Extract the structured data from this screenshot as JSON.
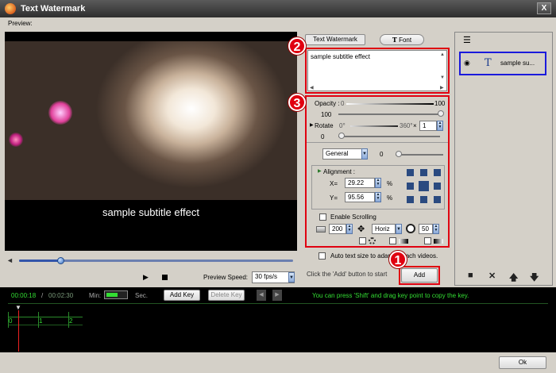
{
  "window": {
    "title": "Text Watermark",
    "close_label": "X"
  },
  "preview": {
    "label": "Preview:",
    "subtitle_text": "sample subtitle effect",
    "speed_label": "Preview Speed:",
    "speed_value": "30 fps/s",
    "volume_level": 0.15
  },
  "tabs": {
    "text_watermark": "Text Watermark",
    "font": "Font",
    "font_icon": "T"
  },
  "editor": {
    "text": "sample subtitle effect"
  },
  "opacity": {
    "label": "Opacity :",
    "min": "0",
    "max": "100",
    "value": "100"
  },
  "rotate": {
    "label": "Rotate",
    "min": "0°",
    "max": "360°",
    "multiply": "×",
    "times": "1",
    "value": "0"
  },
  "motion": {
    "preset": "General",
    "value": "0"
  },
  "alignment": {
    "label": "Alignment :",
    "x_label": "X=",
    "x_value": "29.22",
    "y_label": "Y=",
    "y_value": "95.56",
    "unit": "%"
  },
  "scrolling": {
    "label": "Enable Scrolling",
    "width": "200",
    "direction": "Horiz",
    "speed": "50"
  },
  "auto_text": {
    "label": "Auto text size to adapt to each videos."
  },
  "hint": {
    "text": "Click the 'Add' button to start",
    "add_label": "Add"
  },
  "layers": {
    "items": [
      {
        "icon": "T",
        "label": "sample su..."
      }
    ]
  },
  "timeline": {
    "current": "00:00:18",
    "separator": "/",
    "total": "00:02:30",
    "min_label": "Min:",
    "sec_label": "Sec.",
    "add_key": "Add Key",
    "delete_key": "Delete Key",
    "tip": "You can press 'Shift' and drag key point to copy the key.",
    "ticks": [
      "0",
      "1",
      "2"
    ]
  },
  "footer": {
    "ok_label": "Ok"
  },
  "badges": {
    "one": "1",
    "two": "2",
    "three": "3"
  }
}
